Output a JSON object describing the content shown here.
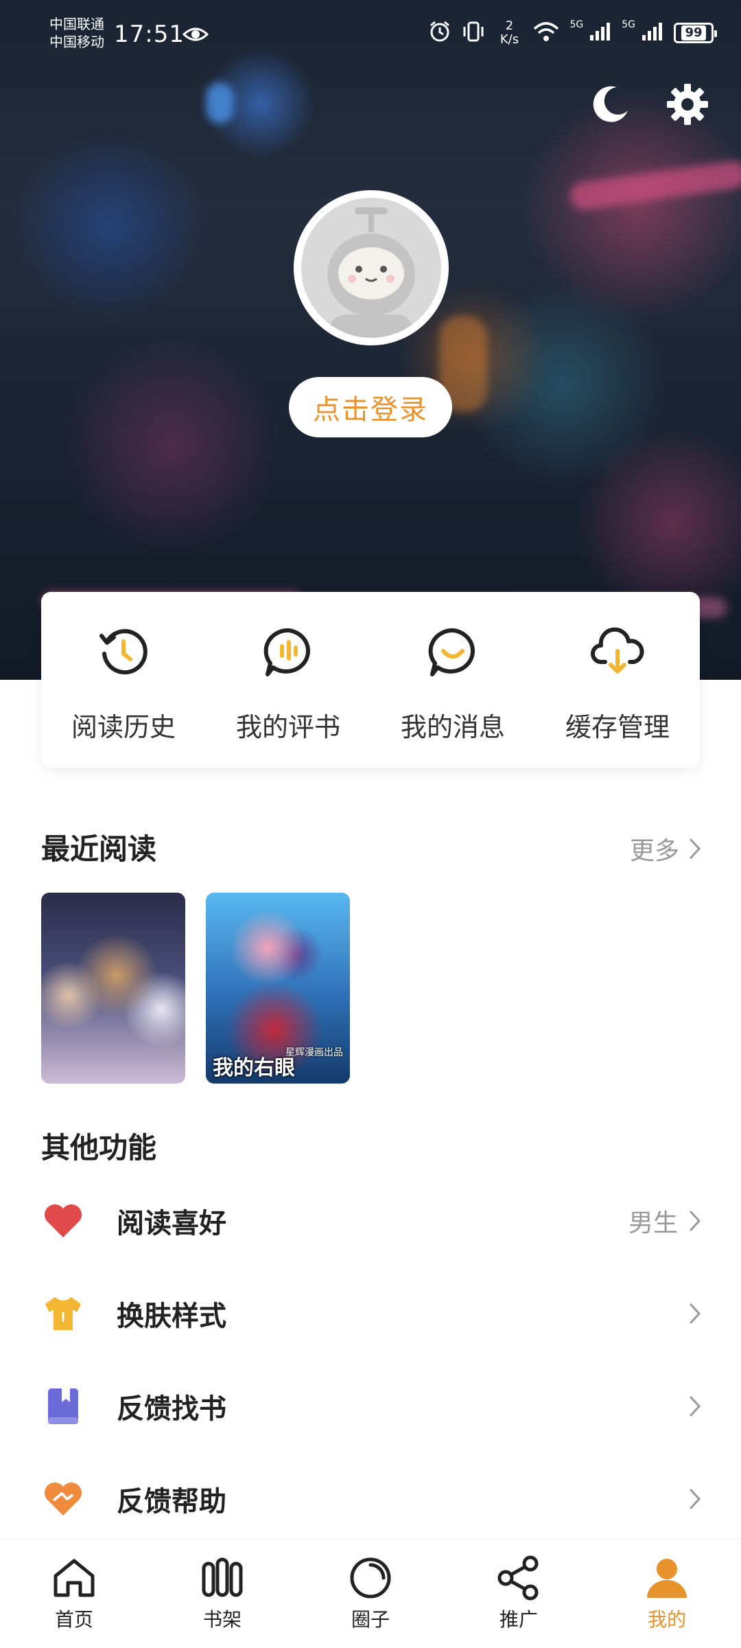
{
  "status_bar": {
    "carrier_1": "中国联通",
    "carrier_2": "中国移动",
    "time": "17:51",
    "net_speed_value": "2",
    "net_speed_unit": "K/s",
    "signal_1": "5G",
    "signal_2": "5G",
    "battery": "99"
  },
  "header": {
    "night_mode_icon": "moon-icon",
    "settings_icon": "gear-icon",
    "login_label": "点击登录"
  },
  "quick_actions": [
    {
      "label": "阅读历史",
      "icon": "history-icon"
    },
    {
      "label": "我的评书",
      "icon": "comment-book-icon"
    },
    {
      "label": "我的消息",
      "icon": "message-icon"
    },
    {
      "label": "缓存管理",
      "icon": "cloud-download-icon"
    }
  ],
  "recent": {
    "title": "最近阅读",
    "more_label": "更多",
    "books": [
      {
        "cover_text": ""
      },
      {
        "cover_text": "我的右眼",
        "cover_subtext": "星辉漫画出品"
      }
    ]
  },
  "other": {
    "title": "其他功能",
    "items": [
      {
        "label": "阅读喜好",
        "value": "男生",
        "icon": "heart-icon"
      },
      {
        "label": "换肤样式",
        "value": "",
        "icon": "tshirt-icon"
      },
      {
        "label": "反馈找书",
        "value": "",
        "icon": "book-icon"
      },
      {
        "label": "反馈帮助",
        "value": "",
        "icon": "help-heart-icon"
      }
    ]
  },
  "bottom_nav": [
    {
      "label": "首页",
      "icon": "home-icon"
    },
    {
      "label": "书架",
      "icon": "bookshelf-icon"
    },
    {
      "label": "圈子",
      "icon": "circle-icon"
    },
    {
      "label": "推广",
      "icon": "share-icon"
    },
    {
      "label": "我的",
      "icon": "profile-icon",
      "active": true
    }
  ],
  "colors": {
    "accent": "#e8922c",
    "heart": "#e04a4a",
    "tshirt": "#f2b632",
    "book": "#6a6ad8",
    "help": "#f08a3c"
  }
}
